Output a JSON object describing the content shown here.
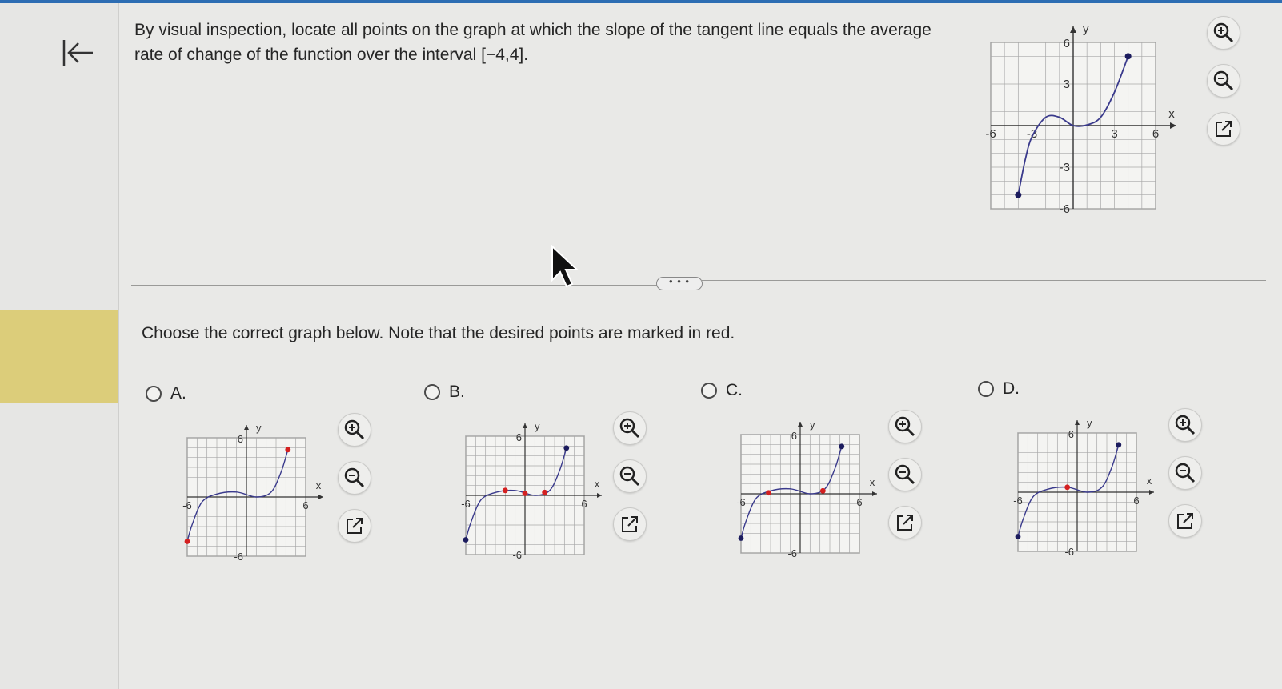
{
  "question": {
    "text": "By visual inspection, locate all points on the graph at which the slope of the tangent line equals the average rate of change of the function over the interval [−4,4]."
  },
  "instruction": "Choose the correct graph below. Note that the desired points are marked in red.",
  "axis_labels": {
    "x": "x",
    "y": "y"
  },
  "tick_labels": {
    "six": "6",
    "neg_six": "-6",
    "three": "3",
    "neg_three": "-3"
  },
  "more_button_label": "• • •",
  "colors": {
    "curve": "#3a3a8c",
    "point": "#1c1c5e",
    "red": "#d42020",
    "grid": "#a8a8a8",
    "accent": "#2d6db3"
  },
  "icons": [
    "back-to-start-icon",
    "zoom-in-icon",
    "zoom-out-icon",
    "popout-icon",
    "mouse-cursor-icon"
  ],
  "main_graph": {
    "xlim": [
      -6,
      6
    ],
    "ylim": [
      -6,
      6
    ],
    "curve": [
      [
        -4,
        -5
      ],
      [
        -3.5,
        -2.5
      ],
      [
        -3,
        -0.8
      ],
      [
        -2,
        0.6
      ],
      [
        -1,
        0.6
      ],
      [
        0,
        0
      ],
      [
        1,
        0.05
      ],
      [
        2,
        0.6
      ],
      [
        3,
        2.4
      ],
      [
        4,
        5
      ]
    ],
    "endpoints": [
      [
        -4,
        -5
      ],
      [
        4,
        5
      ]
    ],
    "red_points": []
  },
  "options": [
    {
      "letter": "A.",
      "graph": {
        "xlim": [
          -6,
          6
        ],
        "ylim": [
          -6,
          6
        ],
        "curve": [
          [
            -6,
            -4.5
          ],
          [
            -5.5,
            -2.8
          ],
          [
            -4.5,
            -0.5
          ],
          [
            -3,
            0.3
          ],
          [
            -1,
            0.5
          ],
          [
            1,
            0
          ],
          [
            2.5,
            0.5
          ],
          [
            3.5,
            2.5
          ],
          [
            4.2,
            4.8
          ]
        ],
        "endpoints": [],
        "red_points": [
          [
            -6,
            -4.5
          ],
          [
            4.2,
            4.8
          ]
        ]
      }
    },
    {
      "letter": "B.",
      "graph": {
        "xlim": [
          -6,
          6
        ],
        "ylim": [
          -6,
          6
        ],
        "curve": [
          [
            -6,
            -4.5
          ],
          [
            -5.5,
            -2.8
          ],
          [
            -4.5,
            -0.5
          ],
          [
            -3,
            0.3
          ],
          [
            -1,
            0.5
          ],
          [
            1,
            0
          ],
          [
            2.5,
            0.5
          ],
          [
            3.5,
            2.5
          ],
          [
            4.2,
            4.8
          ]
        ],
        "endpoints": [
          [
            -6,
            -4.5
          ],
          [
            4.2,
            4.8
          ]
        ],
        "red_points": [
          [
            -2,
            0.5
          ],
          [
            0,
            0.2
          ],
          [
            2,
            0.3
          ]
        ]
      }
    },
    {
      "letter": "C.",
      "graph": {
        "xlim": [
          -6,
          6
        ],
        "ylim": [
          -6,
          6
        ],
        "curve": [
          [
            -6,
            -4.5
          ],
          [
            -5.5,
            -2.8
          ],
          [
            -4.5,
            -0.5
          ],
          [
            -3,
            0.3
          ],
          [
            -1,
            0.5
          ],
          [
            1,
            0
          ],
          [
            2.5,
            0.5
          ],
          [
            3.5,
            2.5
          ],
          [
            4.2,
            4.8
          ]
        ],
        "endpoints": [
          [
            -6,
            -4.5
          ],
          [
            4.2,
            4.8
          ]
        ],
        "red_points": [
          [
            -3.2,
            0.1
          ],
          [
            2.3,
            0.3
          ]
        ]
      }
    },
    {
      "letter": "D.",
      "graph": {
        "xlim": [
          -6,
          6
        ],
        "ylim": [
          -6,
          6
        ],
        "curve": [
          [
            -6,
            -4.5
          ],
          [
            -5.5,
            -2.8
          ],
          [
            -4.5,
            -0.5
          ],
          [
            -3,
            0.3
          ],
          [
            -1,
            0.5
          ],
          [
            1,
            0
          ],
          [
            2.5,
            0.5
          ],
          [
            3.5,
            2.5
          ],
          [
            4.2,
            4.8
          ]
        ],
        "endpoints": [
          [
            -6,
            -4.5
          ],
          [
            4.2,
            4.8
          ]
        ],
        "red_points": [
          [
            -1,
            0.5
          ]
        ]
      }
    }
  ]
}
